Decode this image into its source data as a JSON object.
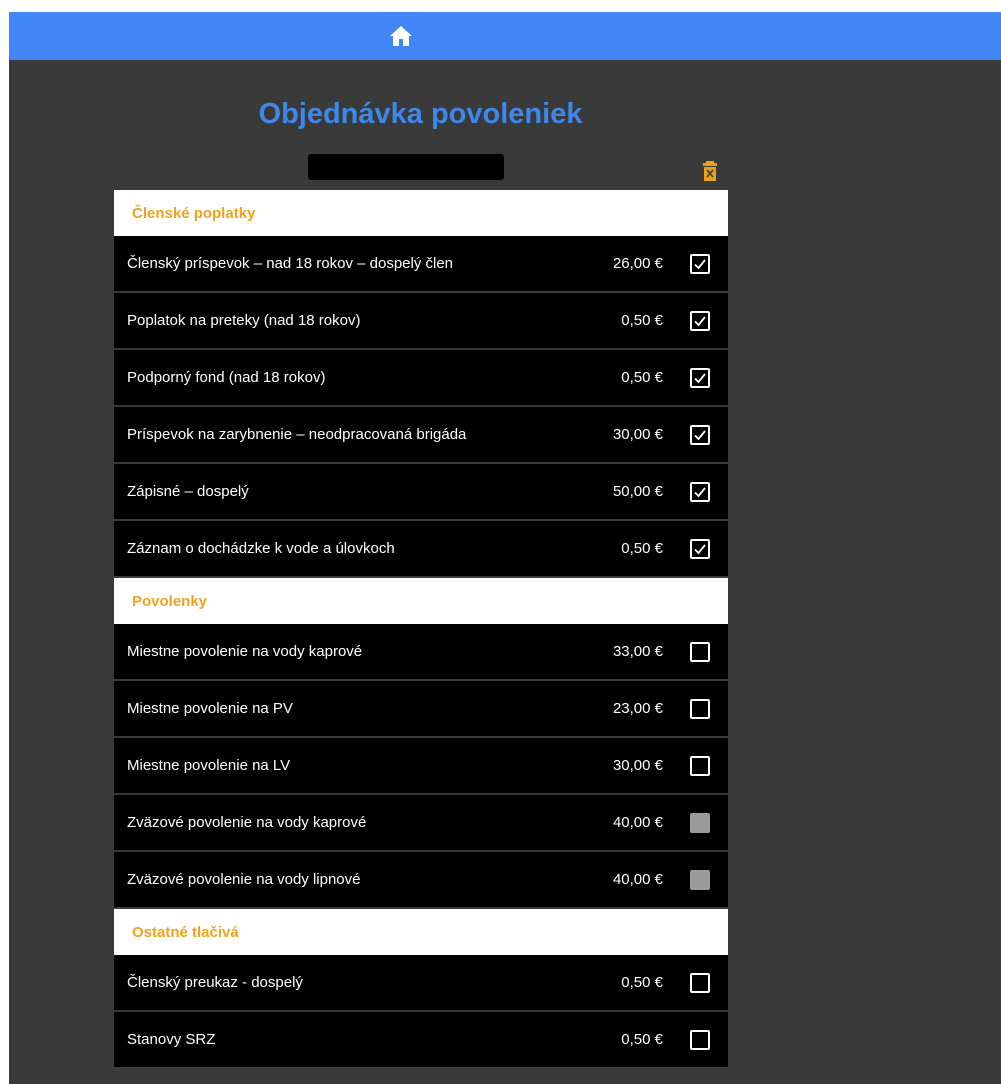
{
  "header": {
    "home_icon": "home-icon"
  },
  "page": {
    "title": "Objednávka povoleniek",
    "delete_icon": "trash-icon",
    "accent_color": "#4285f4",
    "section_color": "#f0a21e"
  },
  "sections": [
    {
      "title": "Členské poplatky",
      "items": [
        {
          "name": "Členský príspevok – nad 18 rokov – dospelý člen",
          "price": "26,00 €",
          "checked": true,
          "disabled": false
        },
        {
          "name": "Poplatok na preteky (nad 18 rokov)",
          "price": "0,50 €",
          "checked": true,
          "disabled": false
        },
        {
          "name": "Podporný fond (nad 18 rokov)",
          "price": "0,50 €",
          "checked": true,
          "disabled": false
        },
        {
          "name": "Príspevok na zarybnenie – neodpracovaná brigáda",
          "price": "30,00 €",
          "checked": true,
          "disabled": false
        },
        {
          "name": "Zápisné – dospelý",
          "price": "50,00 €",
          "checked": true,
          "disabled": false
        },
        {
          "name": "Záznam o dochádzke k vode a úlovkoch",
          "price": "0,50 €",
          "checked": true,
          "disabled": false
        }
      ]
    },
    {
      "title": "Povolenky",
      "items": [
        {
          "name": "Miestne povolenie na vody kaprové",
          "price": "33,00 €",
          "checked": false,
          "disabled": false
        },
        {
          "name": "Miestne povolenie na PV",
          "price": "23,00 €",
          "checked": false,
          "disabled": false
        },
        {
          "name": "Miestne povolenie na LV",
          "price": "30,00 €",
          "checked": false,
          "disabled": false
        },
        {
          "name": "Zväzové povolenie na vody kaprové",
          "price": "40,00 €",
          "checked": false,
          "disabled": true
        },
        {
          "name": "Zväzové povolenie na vody lipnové",
          "price": "40,00 €",
          "checked": false,
          "disabled": true
        }
      ]
    },
    {
      "title": "Ostatné tlačivá",
      "items": [
        {
          "name": "Členský preukaz - dospelý",
          "price": "0,50 €",
          "checked": false,
          "disabled": false
        },
        {
          "name": "Stanovy SRZ",
          "price": "0,50 €",
          "checked": false,
          "disabled": false
        }
      ]
    }
  ]
}
